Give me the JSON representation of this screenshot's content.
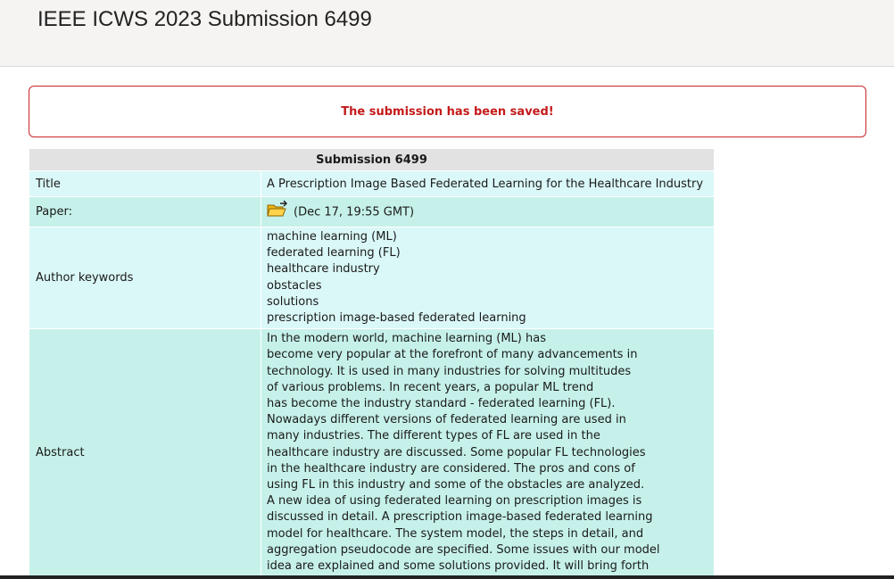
{
  "header": {
    "title": "IEEE ICWS 2023 Submission 6499"
  },
  "alert": {
    "message": "The submission has been saved!"
  },
  "table": {
    "heading": "Submission 6499",
    "title_label": "Title",
    "title_value": "A Prescription Image Based Federated Learning for the Healthcare Industry",
    "paper_label": "Paper:",
    "paper_icon": "folder-icon",
    "paper_date": "(Dec 17, 19:55 GMT)",
    "keywords_label": "Author keywords",
    "keywords": [
      "machine learning (ML)",
      "federated learning (FL)",
      "healthcare industry",
      "obstacles",
      "solutions",
      "prescription image-based federated learning"
    ],
    "abstract_label": "Abstract",
    "abstract_lines": [
      "In the modern world, machine learning (ML) has",
      "become very popular at the forefront of many advancements in",
      "technology. It is used in many industries for solving multitudes",
      "of various problems. In recent years, a popular ML trend",
      "has become the industry standard - federated learning (FL).",
      "Nowadays different versions of federated learning are used in",
      "many industries. The different types of FL are used in the",
      "healthcare industry are discussed. Some popular FL technologies",
      "in the healthcare industry are considered. The pros and cons of",
      "using FL in this industry and some of the obstacles are analyzed.",
      "A new idea of using federated learning on prescription images is",
      "discussed in detail. A prescription image-based federated learning",
      "model for healthcare. The system model, the steps in detail, and",
      "aggregation pseudocode are specified. Some issues with our model",
      "idea are explained and some solutions provided. It will bring forth"
    ]
  },
  "colors": {
    "header_bg": "#f5f4f2",
    "alert_border": "#c92626",
    "alert_text": "#c41a1a",
    "table_heading_bg": "#e2e2e2",
    "row_light": "#dbf8f8",
    "row_dark": "#c6f1ea"
  }
}
